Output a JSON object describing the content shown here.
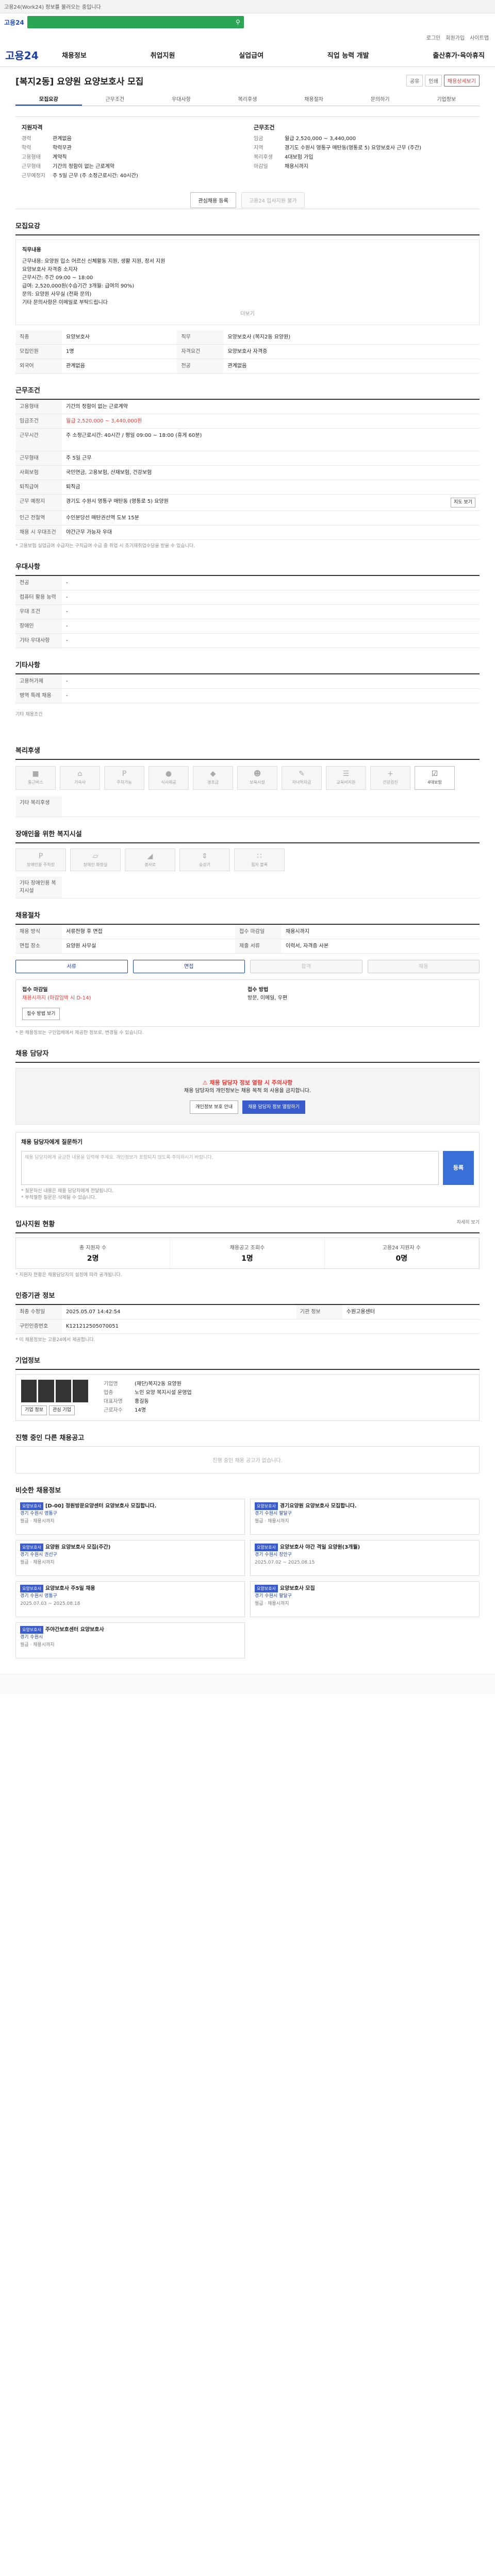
{
  "topbar": {
    "notice": "고용24(Work24) 정보를 불러오는 중입니다"
  },
  "search": {
    "logo": "고용24"
  },
  "toplinks": [
    "로그인",
    "회원가입",
    "사이트맵"
  ],
  "gnb": {
    "brand": "고용24",
    "menu": [
      "채용정보",
      "취업지원",
      "실업급여",
      "직업 능력 개발",
      "출산휴가·육아휴직"
    ]
  },
  "title": {
    "text": "[복지2동] 요양원 요양보호사 모집",
    "btn_share": "공유",
    "btn_print": "인쇄",
    "btn_apply": "채용상세보기"
  },
  "tabs": [
    "모집요강",
    "근무조건",
    "우대사항",
    "복리후생",
    "채용절차",
    "문의하기",
    "기업정보"
  ],
  "summary": {
    "left_title": "지원자격",
    "left": [
      {
        "k": "경력",
        "v": "관계없음"
      },
      {
        "k": "학력",
        "v": "학력무관"
      },
      {
        "k": "고용형태",
        "v": "계약직"
      },
      {
        "k": "근무형태",
        "v": "기간의 정함이 없는 근로계약"
      },
      {
        "k": "근무예정지",
        "v": "주 5일 근무 (주 소정근로시간: 40시간)"
      }
    ],
    "right_title": "근무조건",
    "right": [
      {
        "k": "임금",
        "v": "월급 2,520,000 ~ 3,440,000"
      },
      {
        "k": "지역",
        "v": "경기도 수원시 영통구 매탄동(영통로 5) 요양보호사 근무 (주간)"
      },
      {
        "k": "복리후생",
        "v": "4대보험 가입"
      },
      {
        "k": "마감일",
        "v": "채용시까지"
      }
    ],
    "btn_interest": "관심채용 등록",
    "btn_online": "고용24 입사지원 불가"
  },
  "sections": {
    "recruit": "모집요강",
    "work": "근무조건",
    "prefer": "우대사항",
    "etc": "기타사항",
    "welfare": "복리후생",
    "disabled": "장애인을 위한 복지시설",
    "apply_method": "채용절차",
    "contact": "채용 담당자",
    "question": "채용 담당자에게 질문하기",
    "status": "입사지원 현황",
    "company": "기업정보",
    "other": "진행 중인 다른 채용공고",
    "recommend": "비슷한 채용정보"
  },
  "recruit": {
    "desc_title": "직무내용",
    "desc_lines": [
      "근무내용: 요양원 입소 어르신 신체활동 지원, 생활 지원, 정서 지원",
      "요양보호사 자격증 소지자",
      "근무시간: 주간 09:00 ~ 18:00",
      "급여: 2,520,000원(수습기간 3개월: 급여의 90%)",
      "문의: 요양원 사무실 (전화 문의)",
      "기타 문의사항은 이메일로 부탁드립니다"
    ],
    "more": "더보기",
    "rows": [
      {
        "k": "직종",
        "v": "요양보호사"
      },
      {
        "k": "직무",
        "v": "요양보호사 (복지2동 요양원)"
      },
      {
        "k": "모집인원",
        "v": "1명"
      },
      {
        "k": "자격요건",
        "v": "요양보호사 자격증"
      },
      {
        "k": "외국어",
        "v": "관계없음"
      },
      {
        "k": "전공",
        "v": "관계없음"
      }
    ]
  },
  "work": {
    "rows": [
      {
        "k": "고용형태",
        "v": "기간의 정함이 없는 근로계약"
      },
      {
        "k": "임금조건",
        "v": "월급 2,520,000 ~ 3,440,000원"
      },
      {
        "k": "근무시간",
        "v": "주 소정근로시간: 40시간 / 평일 09:00 ~ 18:00 (휴게 60분)"
      },
      {
        "k": "근무형태",
        "v": "주 5일 근무"
      },
      {
        "k": "사회보험",
        "v": "국민연금, 고용보험, 산재보험, 건강보험"
      },
      {
        "k": "퇴직급여",
        "v": "퇴직금"
      },
      {
        "k": "근무 예정지",
        "v": "경기도 수원시 영통구 매탄동 (영통로 5) 요양원"
      },
      {
        "k": "인근 전철역",
        "v": "수인분당선 매탄권선역 도보 15분"
      },
      {
        "k": "채용 시 우대조건",
        "v": "야간근무 가능자 우대"
      }
    ],
    "map_btn": "지도 보기",
    "note": "* 고용보험 실업급여 수급자는 구직급여 수급 중 취업 시 조기재취업수당을 받을 수 있습니다."
  },
  "prefer": {
    "rows": [
      {
        "k": "전공",
        "v": "-"
      },
      {
        "k": "컴퓨터 활용 능력",
        "v": "-"
      },
      {
        "k": "우대 조건",
        "v": "-"
      },
      {
        "k": "장애인",
        "v": "-"
      },
      {
        "k": "기타 우대사항",
        "v": "-"
      }
    ]
  },
  "etc": {
    "rows": [
      {
        "k": "고용허가제",
        "v": "-"
      },
      {
        "k": "병역 특례 채용",
        "v": "-"
      }
    ],
    "note": "기타 채용조건"
  },
  "welfare": {
    "items": [
      {
        "label": "통근버스",
        "on": false
      },
      {
        "label": "기숙사",
        "on": false
      },
      {
        "label": "주차가능",
        "on": false
      },
      {
        "label": "식사제공",
        "on": false
      },
      {
        "label": "경조금",
        "on": false
      },
      {
        "label": "보육시설",
        "on": false
      },
      {
        "label": "자녀학자금",
        "on": false
      },
      {
        "label": "교육비지원",
        "on": false
      },
      {
        "label": "건강검진",
        "on": false
      },
      {
        "label": "4대보험",
        "on": true
      }
    ],
    "etc": "기타 복리후생"
  },
  "disabled": {
    "items": [
      "장애인용 주차장",
      "장애인 화장실",
      "경사로",
      "승강기",
      "점자 블록"
    ],
    "etc": "기타 장애인용 복지시설"
  },
  "apply_method": {
    "rows": [
      {
        "k": "채용 방식",
        "v": "서류전형 후 면접"
      },
      {
        "k": "접수 마감일",
        "v": "채용시까지"
      },
      {
        "k": "면접 장소",
        "v": "요양원 사무실"
      },
      {
        "k": "제출 서류",
        "v": "이력서, 자격증 사본"
      }
    ],
    "steps": [
      "서류",
      "면접",
      "합격",
      "채용"
    ],
    "left_title": "접수 마감일",
    "left_value": "채용시까지 (마감임박 시 D-14)",
    "right_title": "접수 방법",
    "right_value": "방문, 이메일, 우편",
    "btn": "접수 방법 보기",
    "note": "* 본 채용정보는 구인업체에서 제공한 정보로, 변경될 수 있습니다."
  },
  "contact": {
    "title": "채용 담당자 정보 열람 시 주의사항",
    "body": "채용 담당자의 개인정보는 채용 목적 외 사용을 금지합니다.",
    "btn1": "개인정보 보호 안내",
    "btn2": "채용 담당자 정보 열람하기"
  },
  "question": {
    "placeholder": "채용 담당자에게 궁금한 내용을 입력해 주세요. 개인정보가 포함되지 않도록 주의하시기 바랍니다.",
    "btn": "등록",
    "notes": [
      "* 질문하신 내용은 채용 담당자에게 전달됩니다.",
      "* 부적절한 질문은 삭제될 수 있습니다."
    ]
  },
  "status": {
    "more": "자세히 보기",
    "items": [
      {
        "label": "총 지원자 수",
        "value": "2명"
      },
      {
        "label": "채용공고 조회수",
        "value": "1명"
      },
      {
        "label": "고용24 지원자 수",
        "value": "0명"
      }
    ],
    "note": "* 지원자 현황은 채용담당자의 설정에 따라 공개됩니다."
  },
  "notice_info": {
    "title": "인증기관 정보",
    "rows": [
      {
        "k": "최종 수정일",
        "v": "2025.05.07 14:42:54"
      },
      {
        "k": "기관 정보",
        "v": "수원고용센터"
      },
      {
        "k": "구인인증번호",
        "v": "K121212505070051"
      }
    ],
    "note": "* 이 채용정보는 고용24에서 제공합니다."
  },
  "company": {
    "rows": [
      {
        "k": "기업명",
        "v": "(재단)복지2동 요양원"
      },
      {
        "k": "업종",
        "v": "노인 요양 복지시설 운영업"
      },
      {
        "k": "대표자명",
        "v": "홍길동"
      },
      {
        "k": "근로자수",
        "v": "14명"
      }
    ],
    "btn1": "기업 정보",
    "btn2": "관심 기업"
  },
  "other": {
    "empty": "진행 중인 채용 공고가 없습니다."
  },
  "recommend": {
    "cards": [
      {
        "badge": "요양보호사",
        "title": "[D-00] 정원방문요양센터 요양보호사 모집합니다.",
        "loc": "경기 수원시 영통구",
        "meta": "월급 · 채용시까지"
      },
      {
        "badge": "요양보호사",
        "title": "경기요양원 요양보호사 모집합니다.",
        "loc": "경기 수원시 팔달구",
        "meta": "월급 · 채용시까지"
      },
      {
        "badge": "요양보호사",
        "title": "요양원 요양보호사 모집(주간)",
        "loc": "경기 수원시 권선구",
        "meta": "월급 · 채용시까지"
      },
      {
        "badge": "요양보호사",
        "title": "요양보호사 야간 격일 요양원(3개월)",
        "loc": "경기 수원시 장안구",
        "meta": "2025.07.02 ~ 2025.08.15"
      },
      {
        "badge": "요양보호사",
        "title": "요양보호사 주5일 채용",
        "loc": "경기 수원시 영통구",
        "meta": "2025.07.03 ~ 2025.08.18"
      },
      {
        "badge": "요양보호사",
        "title": "요양보호사 모집",
        "loc": "경기 수원시 팔달구",
        "meta": "월급 · 채용시까지"
      },
      {
        "badge": "요양보호사",
        "title": "주야간보호센터 요양보호사",
        "loc": "경기 수원시",
        "meta": "월급 · 채용시까지"
      }
    ]
  }
}
